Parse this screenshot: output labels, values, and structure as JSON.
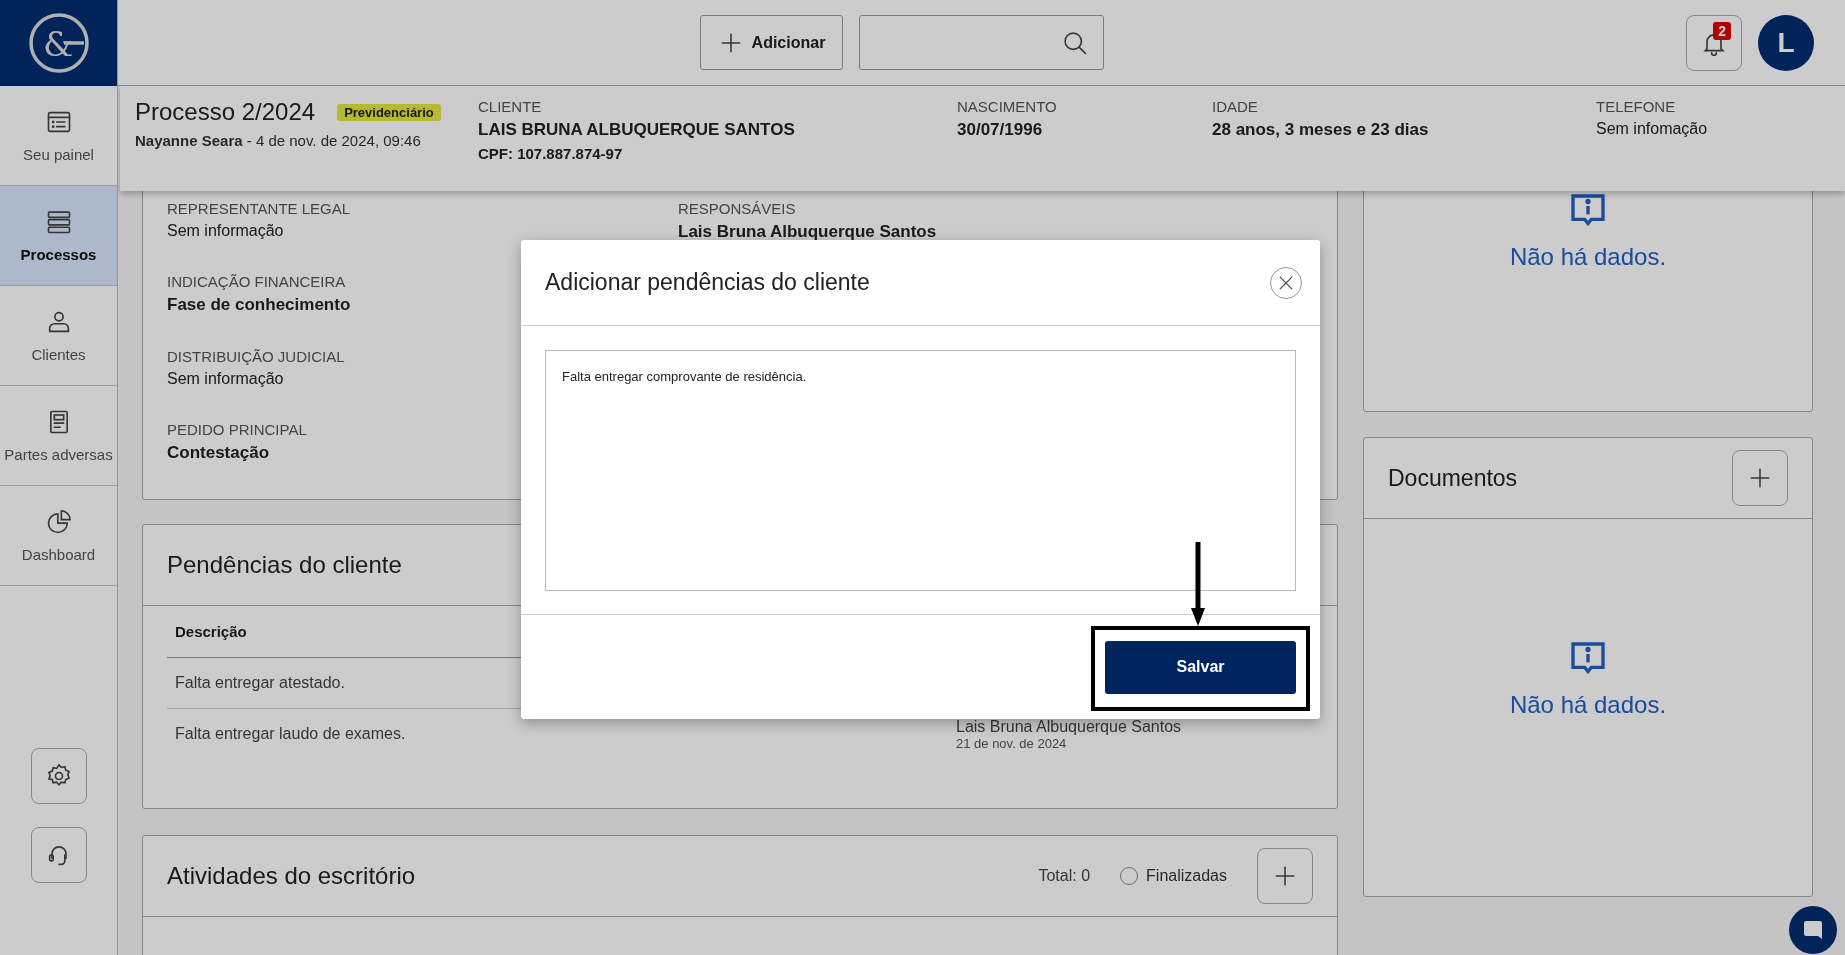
{
  "logo": {
    "mark": "&"
  },
  "sidebar": {
    "items": [
      {
        "label": "Seu painel",
        "selected": false
      },
      {
        "label": "Processos",
        "selected": true
      },
      {
        "label": "Clientes",
        "selected": false
      },
      {
        "label": "Partes adversas",
        "selected": false
      },
      {
        "label": "Dashboard",
        "selected": false
      }
    ]
  },
  "topbar": {
    "add_button": "Adicionar",
    "notification_count": "2",
    "avatar": "L"
  },
  "process_header": {
    "title": "Processo 2/2024",
    "tag": "Previdenciário",
    "subtitle": "**Nayanne Seara** - 4 de nov. de 2024, 09:46",
    "fields": [
      {
        "label": "CLIENTE",
        "value": "LAIS BRUNA ALBUQUERQUE SANTOS",
        "strong": true,
        "extra": "CPF: 107.887.874-97"
      },
      {
        "label": "NASCIMENTO",
        "value": "30/07/1996",
        "strong": true
      },
      {
        "label": "IDADE",
        "value": "28 anos, 3 meses e 23 dias",
        "strong": true
      },
      {
        "label": "TELEFONE",
        "value": "Sem infomação",
        "strong": false
      }
    ]
  },
  "details": {
    "columns": [
      [
        {
          "label": "REPRESENTANTE LEGAL",
          "value": "Sem informação",
          "strong": false
        },
        {
          "label": "INDICAÇÃO FINANCEIRA",
          "value": "Fase de conhecimento",
          "strong": true
        },
        {
          "label": "DISTRIBUIÇÃO JUDICIAL",
          "value": "Sem informação",
          "strong": false
        },
        {
          "label": "PEDIDO PRINCIPAL",
          "value": "Contestação",
          "strong": true
        }
      ],
      [
        {
          "label": "RESPONSÁVEIS",
          "value": "Lais Bruna Albuquerque Santos",
          "strong": true
        }
      ]
    ]
  },
  "pendencias": {
    "title": "Pendências do cliente",
    "columns": [
      "Descrição"
    ],
    "rows": [
      {
        "description": "Falta entregar atestado."
      },
      {
        "description": "Falta entregar laudo de exames.",
        "author": "Lais Bruna Albuquerque Santos",
        "date": "21 de nov. de 2024"
      }
    ]
  },
  "atividades": {
    "title": "Atividades do escritório",
    "total": "Total: 0",
    "filter": {
      "label": "Finalizadas",
      "checked": false
    }
  },
  "empty_panel": {
    "message": "Não há dados."
  },
  "documentos": {
    "title": "Documentos",
    "message": "Não há dados."
  },
  "modal": {
    "title": "Adicionar pendências do cliente",
    "text": "Falta entregar comprovante de residência.",
    "save_button": "Salvar"
  }
}
